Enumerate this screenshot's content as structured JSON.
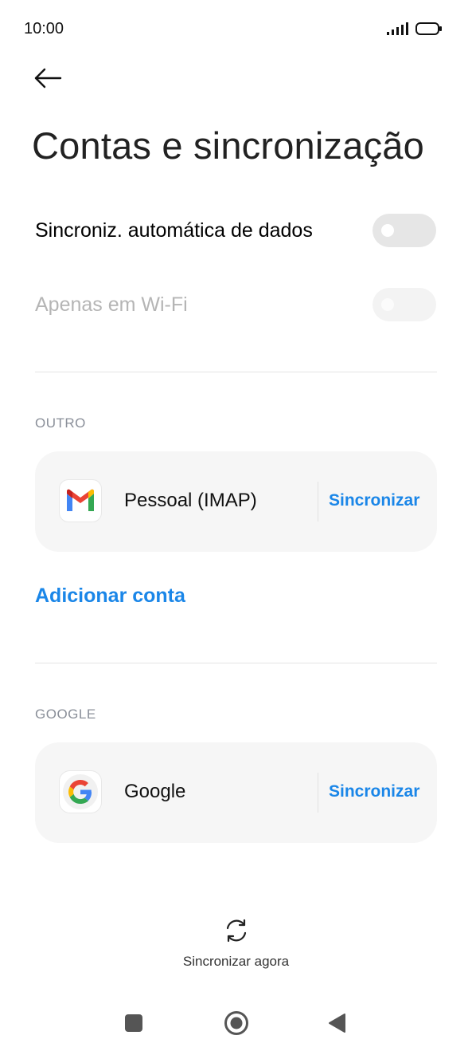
{
  "status_bar": {
    "time": "10:00"
  },
  "header": {
    "title": "Contas e sincronização"
  },
  "settings": {
    "auto_sync": {
      "label": "Sincroniz. automática de dados",
      "enabled": false
    },
    "wifi_only": {
      "label": "Apenas em Wi-Fi",
      "enabled": false,
      "disabled": true
    }
  },
  "sections": {
    "other": {
      "header": "OUTRO",
      "account": {
        "name": "Pessoal (IMAP)",
        "icon": "gmail-icon",
        "sync_label": "Sincronizar"
      }
    },
    "add_account_label": "Adicionar conta",
    "google": {
      "header": "GOOGLE",
      "account": {
        "name": "Google",
        "icon": "google-icon",
        "sync_label": "Sincronizar"
      }
    }
  },
  "sync_now": {
    "label": "Sincronizar agora",
    "icon": "sync-icon"
  },
  "colors": {
    "accent": "#1a86e8",
    "card_bg": "#f6f6f6",
    "toggle_off": "#e6e6e6"
  }
}
